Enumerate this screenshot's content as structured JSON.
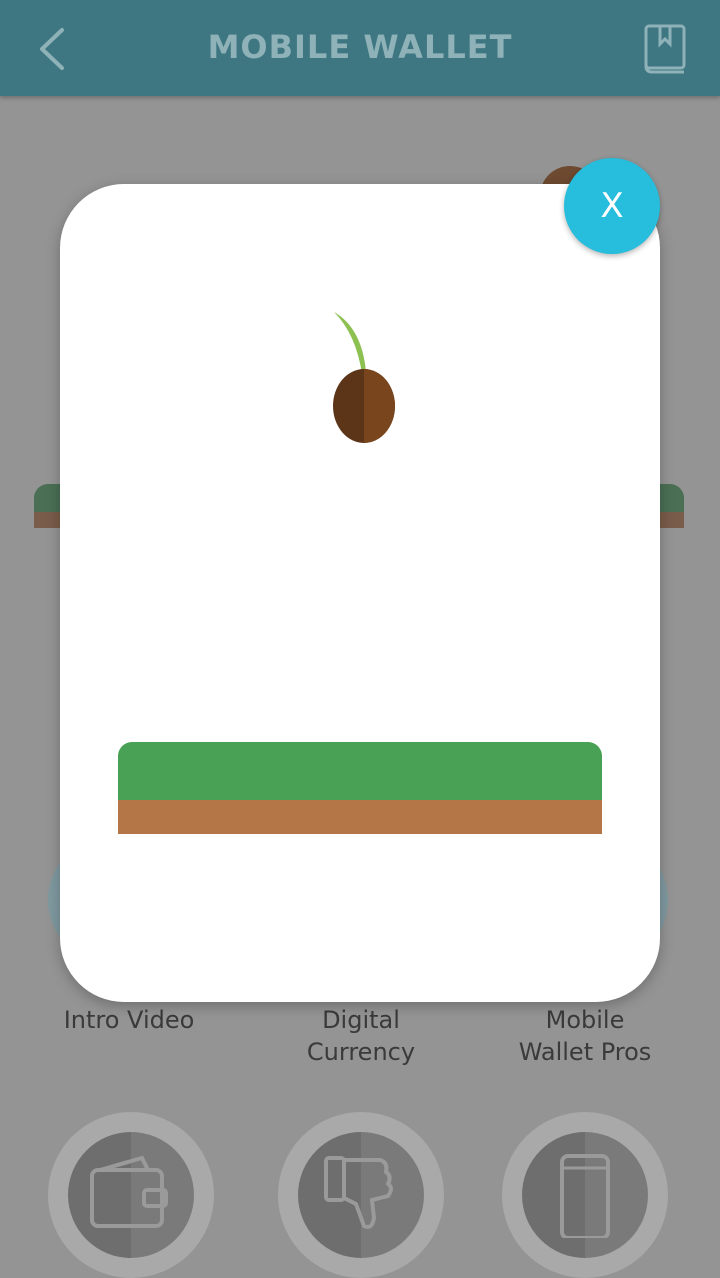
{
  "header": {
    "title": "MOBILE WALLET",
    "back_icon": "back-chevron-icon",
    "bookmark_icon": "book-bookmark-icon",
    "color": "#3e7782"
  },
  "background_menu": {
    "items": [
      {
        "label": "Intro Video"
      },
      {
        "label": "Digital\nCurrency"
      },
      {
        "label": "Mobile\nWallet Pros"
      }
    ],
    "bottom_icons": [
      "wallet-icon",
      "thumbs-down-icon",
      "phone-icon"
    ]
  },
  "modal": {
    "close_label": "X",
    "close_color": "#27bddc",
    "illustration": {
      "seed_icon": "sprouting-seed-icon",
      "grass_color": "#48a154",
      "soil_color": "#b57647"
    }
  }
}
